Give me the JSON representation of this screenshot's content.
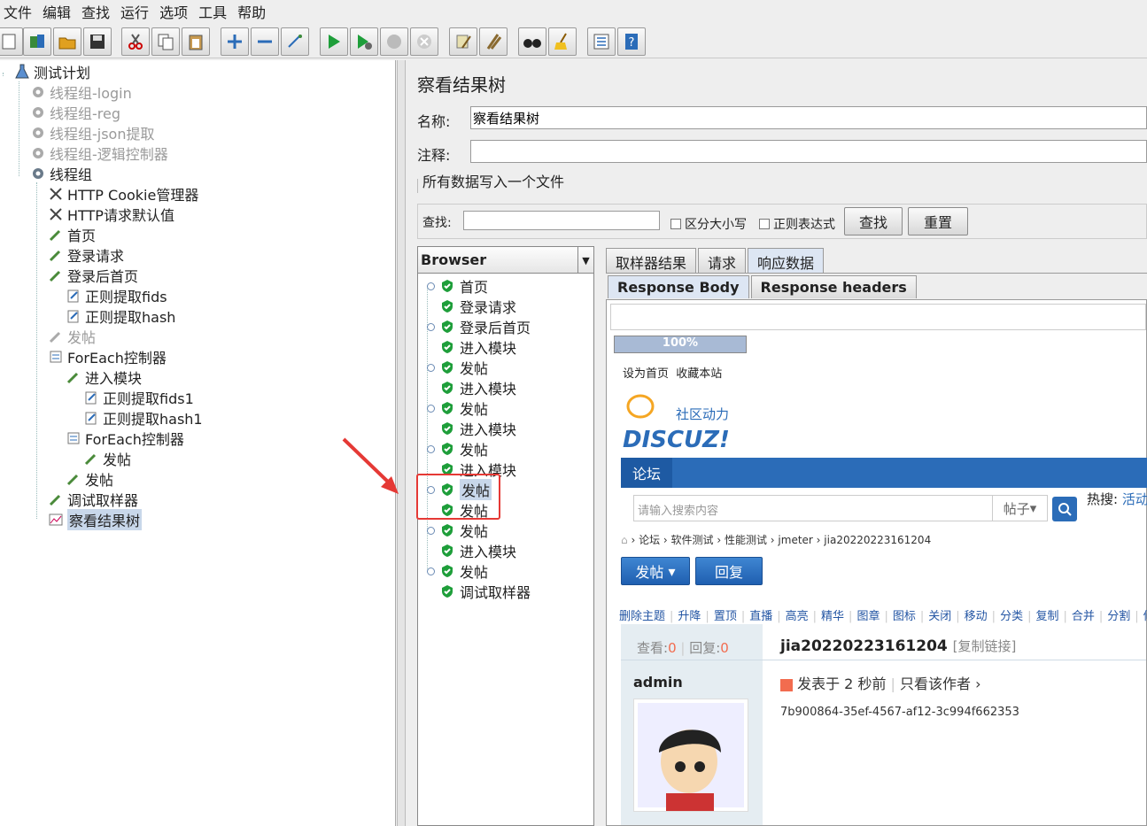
{
  "menu": [
    "文件",
    "编辑",
    "查找",
    "运行",
    "选项",
    "工具",
    "帮助"
  ],
  "left_tree": {
    "root": "测试计划",
    "groups": [
      {
        "label": "线程组-login",
        "disabled": true
      },
      {
        "label": "线程组-reg",
        "disabled": true
      },
      {
        "label": "线程组-json提取",
        "disabled": true
      },
      {
        "label": "线程组-逻辑控制器",
        "disabled": true
      },
      {
        "label": "线程组",
        "disabled": false
      }
    ],
    "children": [
      {
        "label": "HTTP Cookie管理器"
      },
      {
        "label": "HTTP请求默认值"
      },
      {
        "label": "首页"
      },
      {
        "label": "登录请求"
      },
      {
        "label": "登录后首页"
      },
      {
        "label": "正则提取fids"
      },
      {
        "label": "正则提取hash"
      },
      {
        "label": "发帖"
      },
      {
        "label": "ForEach控制器"
      },
      {
        "label": "进入模块"
      },
      {
        "label": "正则提取fids1"
      },
      {
        "label": "正则提取hash1"
      },
      {
        "label": "ForEach控制器"
      },
      {
        "label": "发帖"
      },
      {
        "label": "发帖"
      },
      {
        "label": "调试取样器"
      },
      {
        "label": "察看结果树"
      }
    ]
  },
  "panel": {
    "title": "察看结果树",
    "name_label": "名称:",
    "name_value": "察看结果树",
    "comment_label": "注释:",
    "comment_value": "",
    "file_section": "所有数据写入一个文件",
    "search_label": "查找:",
    "search_value": "",
    "case_label": "区分大小写",
    "regex_label": "正则表达式",
    "find_button": "查找",
    "reset_button": "重置"
  },
  "renderer": {
    "selected": "Browser",
    "results": [
      "首页",
      "登录请求",
      "登录后首页",
      "进入模块",
      "发帖",
      "进入模块",
      "发帖",
      "进入模块",
      "发帖",
      "进入模块",
      "发帖",
      "发帖",
      "发帖",
      "进入模块",
      "发帖",
      "调试取样器"
    ]
  },
  "tabs": [
    "取样器结果",
    "请求",
    "响应数据"
  ],
  "subtabs": [
    "Response Body",
    "Response headers"
  ],
  "progress": "100%",
  "page": {
    "top_links": [
      "设为首页",
      "收藏本站"
    ],
    "logo_sub": "社区动力",
    "logo_main": "DISCUZ!",
    "nav_current": "论坛",
    "search_placeholder": "请输入搜索内容",
    "search_type": "帖子",
    "hot_label": "热搜:",
    "hot_item": "活动",
    "breadcrumb": [
      "论坛",
      "软件测试",
      "性能测试",
      "jmeter",
      "jia20220223161204"
    ],
    "post_btn": "发帖",
    "reply_btn": "回复",
    "mod_actions": [
      "删除主题",
      "升降",
      "置顶",
      "直播",
      "高亮",
      "精华",
      "图章",
      "图标",
      "关闭",
      "移动",
      "分类",
      "复制",
      "合并",
      "分割",
      "修复"
    ],
    "views_label": "查看:",
    "views": "0",
    "replies_label": "回复:",
    "replies": "0",
    "thread_title": "jia20220223161204",
    "copy_link": "[复制链接]",
    "author": "admin",
    "posted": "发表于 2 秒前",
    "only_author": "只看该作者",
    "body": "7b900864-35ef-4567-af12-3c994f662353"
  },
  "colors": {
    "accent": "#2b6cb8",
    "annotation": "#e53935",
    "selected": "#c8d7ea",
    "check": "#1e9e3a"
  }
}
